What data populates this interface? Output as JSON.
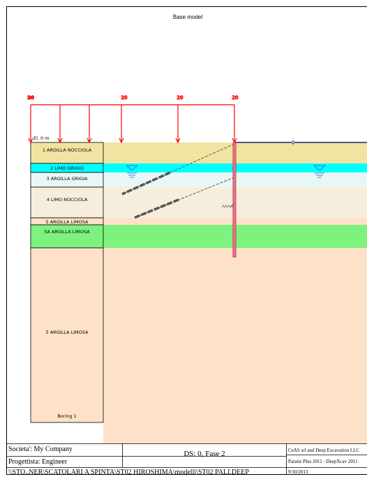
{
  "title": "Base model",
  "loads": {
    "value_labels": [
      "20",
      "20",
      "20",
      "20"
    ],
    "color": "#ff0000"
  },
  "elevation_label": "El. 0 m",
  "soil_layers": [
    {
      "name": "1 ARGILLA NOCCIOLA",
      "color": "#f1e4a2"
    },
    {
      "name": "2 LIMO GRIGIO",
      "color": "#00ffff"
    },
    {
      "name": "3 ARGILLA GRIGIA",
      "color": "#e8f7f5"
    },
    {
      "name": "4 LIMO NOCCIOLA",
      "color": "#f6eedc"
    },
    {
      "name": "5 ARGILLA LIMOSA",
      "color": "#fde1c9"
    },
    {
      "name": "5A ARGILLA LIMOSA",
      "color": "#7df27f"
    },
    {
      "name": "5 ARGILLA LIMOSA",
      "color": "#fde1c9"
    }
  ],
  "boring_label": "Boring 1",
  "colors": {
    "wall": "#c8102e",
    "anchor": "#555555",
    "water": "#1f6fd0"
  },
  "title_block": {
    "company": "Societa': My Company",
    "designer": "Progettista: Engineer",
    "path": "\\\\STO..NER\\SCATOLARI A SPINTA\\ST02 HIROSHIMA\\modelli\\ST02 PALI.DEEP",
    "stage": "DS: 0, Fase 2",
    "software_company": "CeAS srl and Deep Excavation LLC",
    "software": "Paratie Plus 2011 - DeepXcav 2011",
    "date": "9/10/2013"
  }
}
